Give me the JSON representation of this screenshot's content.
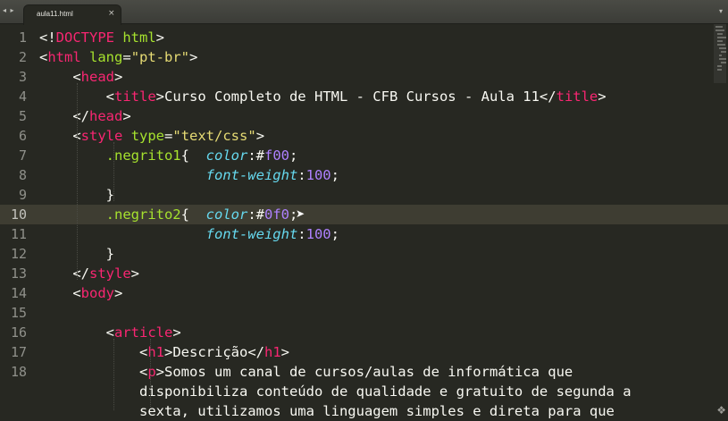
{
  "tabbar": {
    "nav_arrows": "◂ ▸",
    "tab_label": "aula11.html",
    "close_glyph": "×",
    "menu_glyph": "▾"
  },
  "editor": {
    "current_line": 10,
    "line_numbers": [
      "1",
      "2",
      "3",
      "4",
      "5",
      "6",
      "7",
      "8",
      "9",
      "10",
      "11",
      "12",
      "13",
      "14",
      "15",
      "16",
      "17",
      "18",
      "",
      ""
    ],
    "lines": [
      [
        [
          "t-text",
          "<!"
        ],
        [
          "t-tag",
          "DOCTYPE"
        ],
        [
          "t-text",
          " "
        ],
        [
          "t-attr",
          "html"
        ],
        [
          "t-text",
          ">"
        ]
      ],
      [
        [
          "t-text",
          "<"
        ],
        [
          "t-tag",
          "html"
        ],
        [
          "t-text",
          " "
        ],
        [
          "t-attr",
          "lang"
        ],
        [
          "t-text",
          "="
        ],
        [
          "t-str",
          "\"pt-br\""
        ],
        [
          "t-text",
          ">"
        ]
      ],
      [
        [
          "t-text",
          "    <"
        ],
        [
          "t-tag",
          "head"
        ],
        [
          "t-text",
          ">"
        ]
      ],
      [
        [
          "t-text",
          "        <"
        ],
        [
          "t-tag",
          "title"
        ],
        [
          "t-text",
          ">Curso Completo de HTML - CFB Cursos - Aula 11</"
        ],
        [
          "t-tag",
          "title"
        ],
        [
          "t-text",
          ">"
        ]
      ],
      [
        [
          "t-text",
          "    </"
        ],
        [
          "t-tag",
          "head"
        ],
        [
          "t-text",
          ">"
        ]
      ],
      [
        [
          "t-text",
          "    <"
        ],
        [
          "t-tag",
          "style"
        ],
        [
          "t-text",
          " "
        ],
        [
          "t-attr",
          "type"
        ],
        [
          "t-text",
          "="
        ],
        [
          "t-str",
          "\"text/css\""
        ],
        [
          "t-text",
          ">"
        ]
      ],
      [
        [
          "t-text",
          "        "
        ],
        [
          "t-sel",
          ".negrito1"
        ],
        [
          "t-text",
          "{  "
        ],
        [
          "t-prop",
          "color"
        ],
        [
          "t-text",
          ":#"
        ],
        [
          "t-num",
          "f00"
        ],
        [
          "t-text",
          ";"
        ]
      ],
      [
        [
          "t-text",
          "                    "
        ],
        [
          "t-prop",
          "font-weight"
        ],
        [
          "t-text",
          ":"
        ],
        [
          "t-num",
          "100"
        ],
        [
          "t-text",
          ";"
        ]
      ],
      [
        [
          "t-text",
          "        }"
        ]
      ],
      [
        [
          "t-text",
          "        "
        ],
        [
          "t-sel",
          ".negrito2"
        ],
        [
          "t-text",
          "{  "
        ],
        [
          "t-prop",
          "color"
        ],
        [
          "t-text",
          ":#"
        ],
        [
          "t-num",
          "0f0"
        ],
        [
          "t-text",
          ";"
        ]
      ],
      [
        [
          "t-text",
          "                    "
        ],
        [
          "t-prop",
          "font-weight"
        ],
        [
          "t-text",
          ":"
        ],
        [
          "t-num",
          "100"
        ],
        [
          "t-text",
          ";"
        ]
      ],
      [
        [
          "t-text",
          "        }"
        ]
      ],
      [
        [
          "t-text",
          "    </"
        ],
        [
          "t-tag",
          "style"
        ],
        [
          "t-text",
          ">"
        ]
      ],
      [
        [
          "t-text",
          "    <"
        ],
        [
          "t-tag",
          "body"
        ],
        [
          "t-text",
          ">"
        ]
      ],
      [
        [
          "t-text",
          ""
        ]
      ],
      [
        [
          "t-text",
          "        <"
        ],
        [
          "t-tag",
          "article"
        ],
        [
          "t-text",
          ">"
        ]
      ],
      [
        [
          "t-text",
          "            <"
        ],
        [
          "t-tag",
          "h1"
        ],
        [
          "t-text",
          ">Descrição</"
        ],
        [
          "t-tag",
          "h1"
        ],
        [
          "t-text",
          ">"
        ]
      ],
      [
        [
          "t-text",
          "            <"
        ],
        [
          "t-tag",
          "p"
        ],
        [
          "t-text",
          ">Somos um canal de cursos/aulas de informática que"
        ]
      ],
      [
        [
          "t-text",
          "            disponibiliza conteúdo de qualidade e gratuito de segunda a"
        ]
      ],
      [
        [
          "t-text",
          "            sexta, utilizamos uma linguagem simples e direta para que"
        ]
      ]
    ]
  }
}
